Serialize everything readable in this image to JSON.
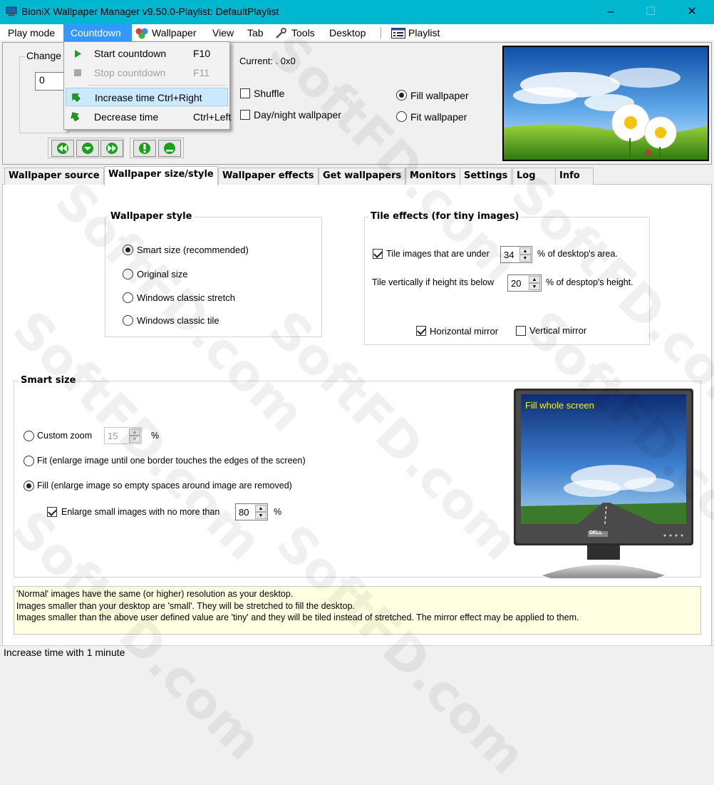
{
  "window": {
    "title": "BioniX Wallpaper Manager  v9.50.0-Playlist: DefaultPlaylist",
    "minimize_glyph": "–",
    "maximize_glyph": "☐",
    "close_glyph": "✕"
  },
  "menu": {
    "items": [
      "Play mode",
      "Countdown",
      "Wallpaper",
      "View",
      "Tab",
      "Tools",
      "Desktop",
      "Playlist"
    ]
  },
  "countdown_menu": {
    "items": [
      {
        "label": "Start countdown",
        "shortcut": "F10"
      },
      {
        "label": "Stop countdown",
        "shortcut": "F11"
      },
      {
        "label": "Increase time Ctrl+Right",
        "shortcut": ""
      },
      {
        "label": "Decrease time",
        "shortcut": "Ctrl+Left"
      }
    ]
  },
  "top_panel": {
    "change_label": "Change w",
    "interval_value": "0",
    "current_label": "Current: .  0x0",
    "shuffle_label": "Shuffle",
    "daynight_label": "Day/night wallpaper",
    "fill_label": "Fill wallpaper",
    "fit_label": "Fit wallpaper"
  },
  "tabs": [
    "Wallpaper source",
    "Wallpaper size/style",
    "Wallpaper effects",
    "Get wallpapers",
    "Monitors",
    "Settings",
    "Log",
    "Info"
  ],
  "wallpaper_style": {
    "title": "Wallpaper style",
    "options": [
      "Smart size (recommended)",
      "Original size",
      "Windows classic stretch",
      "Windows classic tile"
    ],
    "selected": 0
  },
  "tile_effects": {
    "title": "Tile effects (for tiny images)",
    "tile_under_label": "Tile images that are under",
    "tile_under_value": "34",
    "tile_under_suffix": "% of desktop's area.",
    "tile_vert_label": "Tile vertically if height its below",
    "tile_vert_value": "20",
    "tile_vert_suffix": "% of desptop's height.",
    "hmirror_label": "Horizontal mirror",
    "vmirror_label": "Vertical mirror"
  },
  "smart_size": {
    "title": "Smart size",
    "custom_zoom_label": "Custom zoom",
    "custom_zoom_value": "15",
    "percent": "%",
    "fit_label": "Fit (enlarge image until one border touches the edges of the screen)",
    "fill_label": "Fill (enlarge image so empty spaces around image are removed)",
    "enlarge_label": "Enlarge small images with no more than",
    "enlarge_value": "80",
    "enlarge_percent": "%",
    "monitor_caption": "Fill whole screen",
    "monitor_brand": "DELL"
  },
  "info_lines": [
    "'Normal' images have the same (or higher) resolution as your desktop.",
    "Images smaller than your desktop are 'small'. They will be stretched to fill the desktop.",
    "Images smaller than the above user defined value are 'tiny' and they will be tiled instead of stretched. The mirror effect may be applied to them."
  ],
  "status": "Increase time with 1 minute",
  "watermark": "SoftFD.com",
  "colors": {
    "titlebar": "#00b7cf",
    "menu_active": "#3399ff",
    "highlight": "#cce8ff",
    "nav_green": "#1aa01a",
    "monitor_caption": "#f5f500"
  }
}
